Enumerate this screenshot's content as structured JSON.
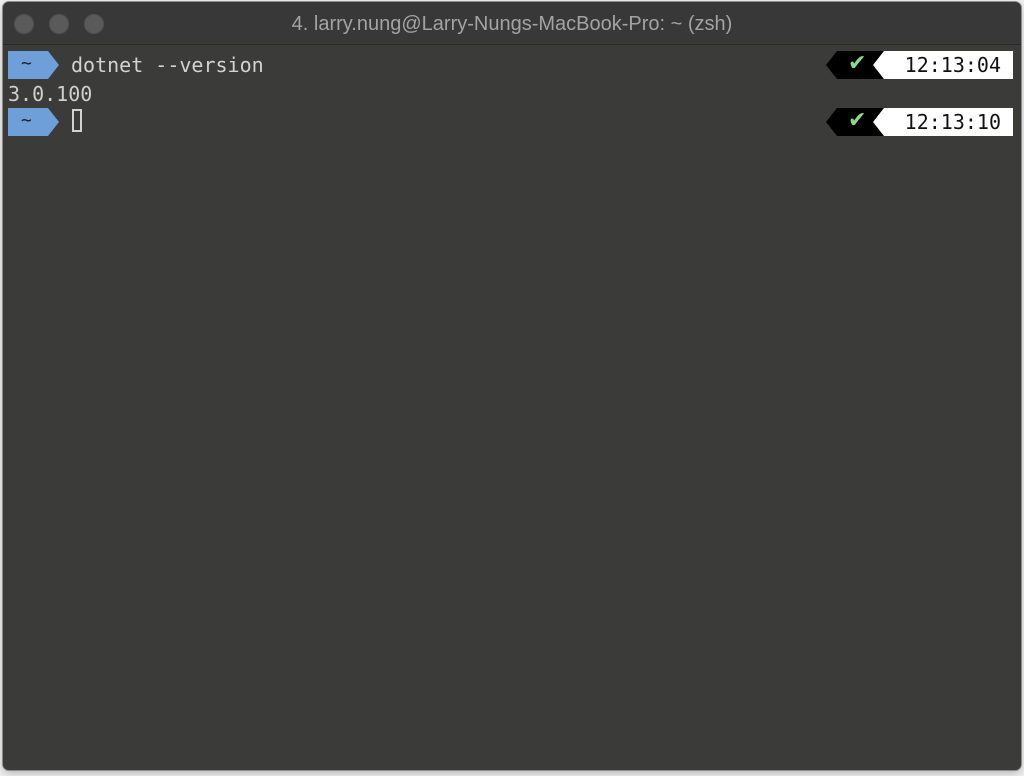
{
  "window": {
    "title": "4. larry.nung@Larry-Nungs-MacBook-Pro: ~ (zsh)",
    "controls": [
      "close",
      "minimize",
      "zoom"
    ]
  },
  "terminal": {
    "background": "#3b3b39",
    "prompt_color": "#6f9fd8",
    "success_color": "#8cd98c",
    "lines": [
      {
        "directory": "~",
        "command": "dotnet --version",
        "status_icon": "check-icon",
        "status": "✔",
        "time": "12:13:04"
      },
      {
        "output": "3.0.100"
      },
      {
        "directory": "~",
        "command": "",
        "status_icon": "check-icon",
        "status": "✔",
        "time": "12:13:10"
      }
    ]
  }
}
